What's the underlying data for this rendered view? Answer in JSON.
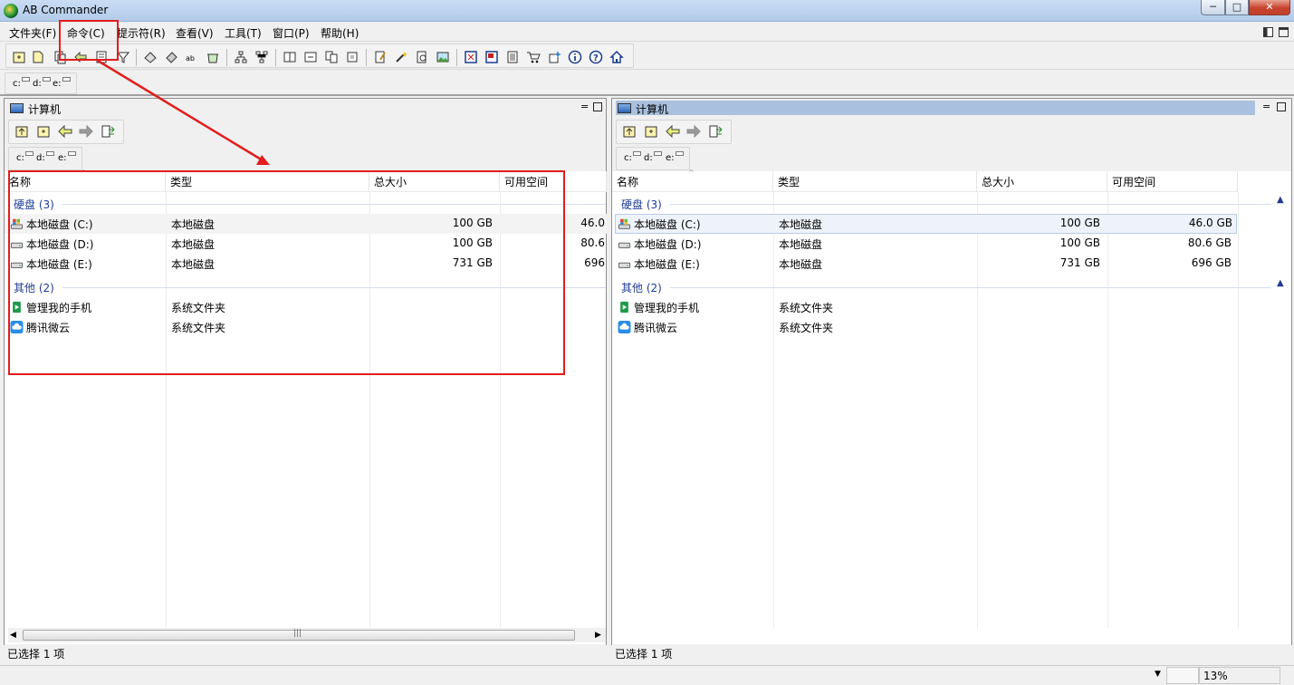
{
  "window": {
    "title": "AB Commander",
    "min": "─",
    "max": "□",
    "close": "✕"
  },
  "menu": [
    "文件夹(F)",
    "命令(C)",
    "提示符(R)",
    "查看(V)",
    "工具(T)",
    "窗口(P)",
    "帮助(H)"
  ],
  "drives": [
    "c:",
    "d:",
    "e:"
  ],
  "panels": [
    {
      "title": "计算机",
      "columns": [
        "名称",
        "类型",
        "总大小",
        "可用空间"
      ],
      "groups": [
        {
          "label": "硬盘 (3)",
          "items": [
            {
              "name": "本地磁盘 (C:)",
              "type": "本地磁盘",
              "total": "100 GB",
              "free": "46.0"
            },
            {
              "name": "本地磁盘 (D:)",
              "type": "本地磁盘",
              "total": "100 GB",
              "free": "80.6"
            },
            {
              "name": "本地磁盘 (E:)",
              "type": "本地磁盘",
              "total": "731 GB",
              "free": "696"
            }
          ]
        },
        {
          "label": "其他 (2)",
          "items": [
            {
              "name": "管理我的手机",
              "type": "系统文件夹",
              "total": "",
              "free": ""
            },
            {
              "name": "腾讯微云",
              "type": "系统文件夹",
              "total": "",
              "free": ""
            }
          ]
        }
      ],
      "status": "已选择 1 项",
      "scroll_grip": "|||"
    },
    {
      "title": "计算机",
      "columns": [
        "名称",
        "类型",
        "总大小",
        "可用空间"
      ],
      "groups": [
        {
          "label": "硬盘 (3)",
          "items": [
            {
              "name": "本地磁盘 (C:)",
              "type": "本地磁盘",
              "total": "100 GB",
              "free": "46.0 GB"
            },
            {
              "name": "本地磁盘 (D:)",
              "type": "本地磁盘",
              "total": "100 GB",
              "free": "80.6 GB"
            },
            {
              "name": "本地磁盘 (E:)",
              "type": "本地磁盘",
              "total": "731 GB",
              "free": "696 GB"
            }
          ]
        },
        {
          "label": "其他 (2)",
          "items": [
            {
              "name": "管理我的手机",
              "type": "系统文件夹",
              "total": "",
              "free": ""
            },
            {
              "name": "腾讯微云",
              "type": "系统文件夹",
              "total": "",
              "free": ""
            }
          ]
        }
      ],
      "status": "已选择 1 项"
    }
  ],
  "bottom": {
    "zoom": "13%"
  },
  "colors": {
    "highlight": "#e21d1d",
    "group_text": "#1e3c96",
    "title_active": "#a9c1de"
  }
}
